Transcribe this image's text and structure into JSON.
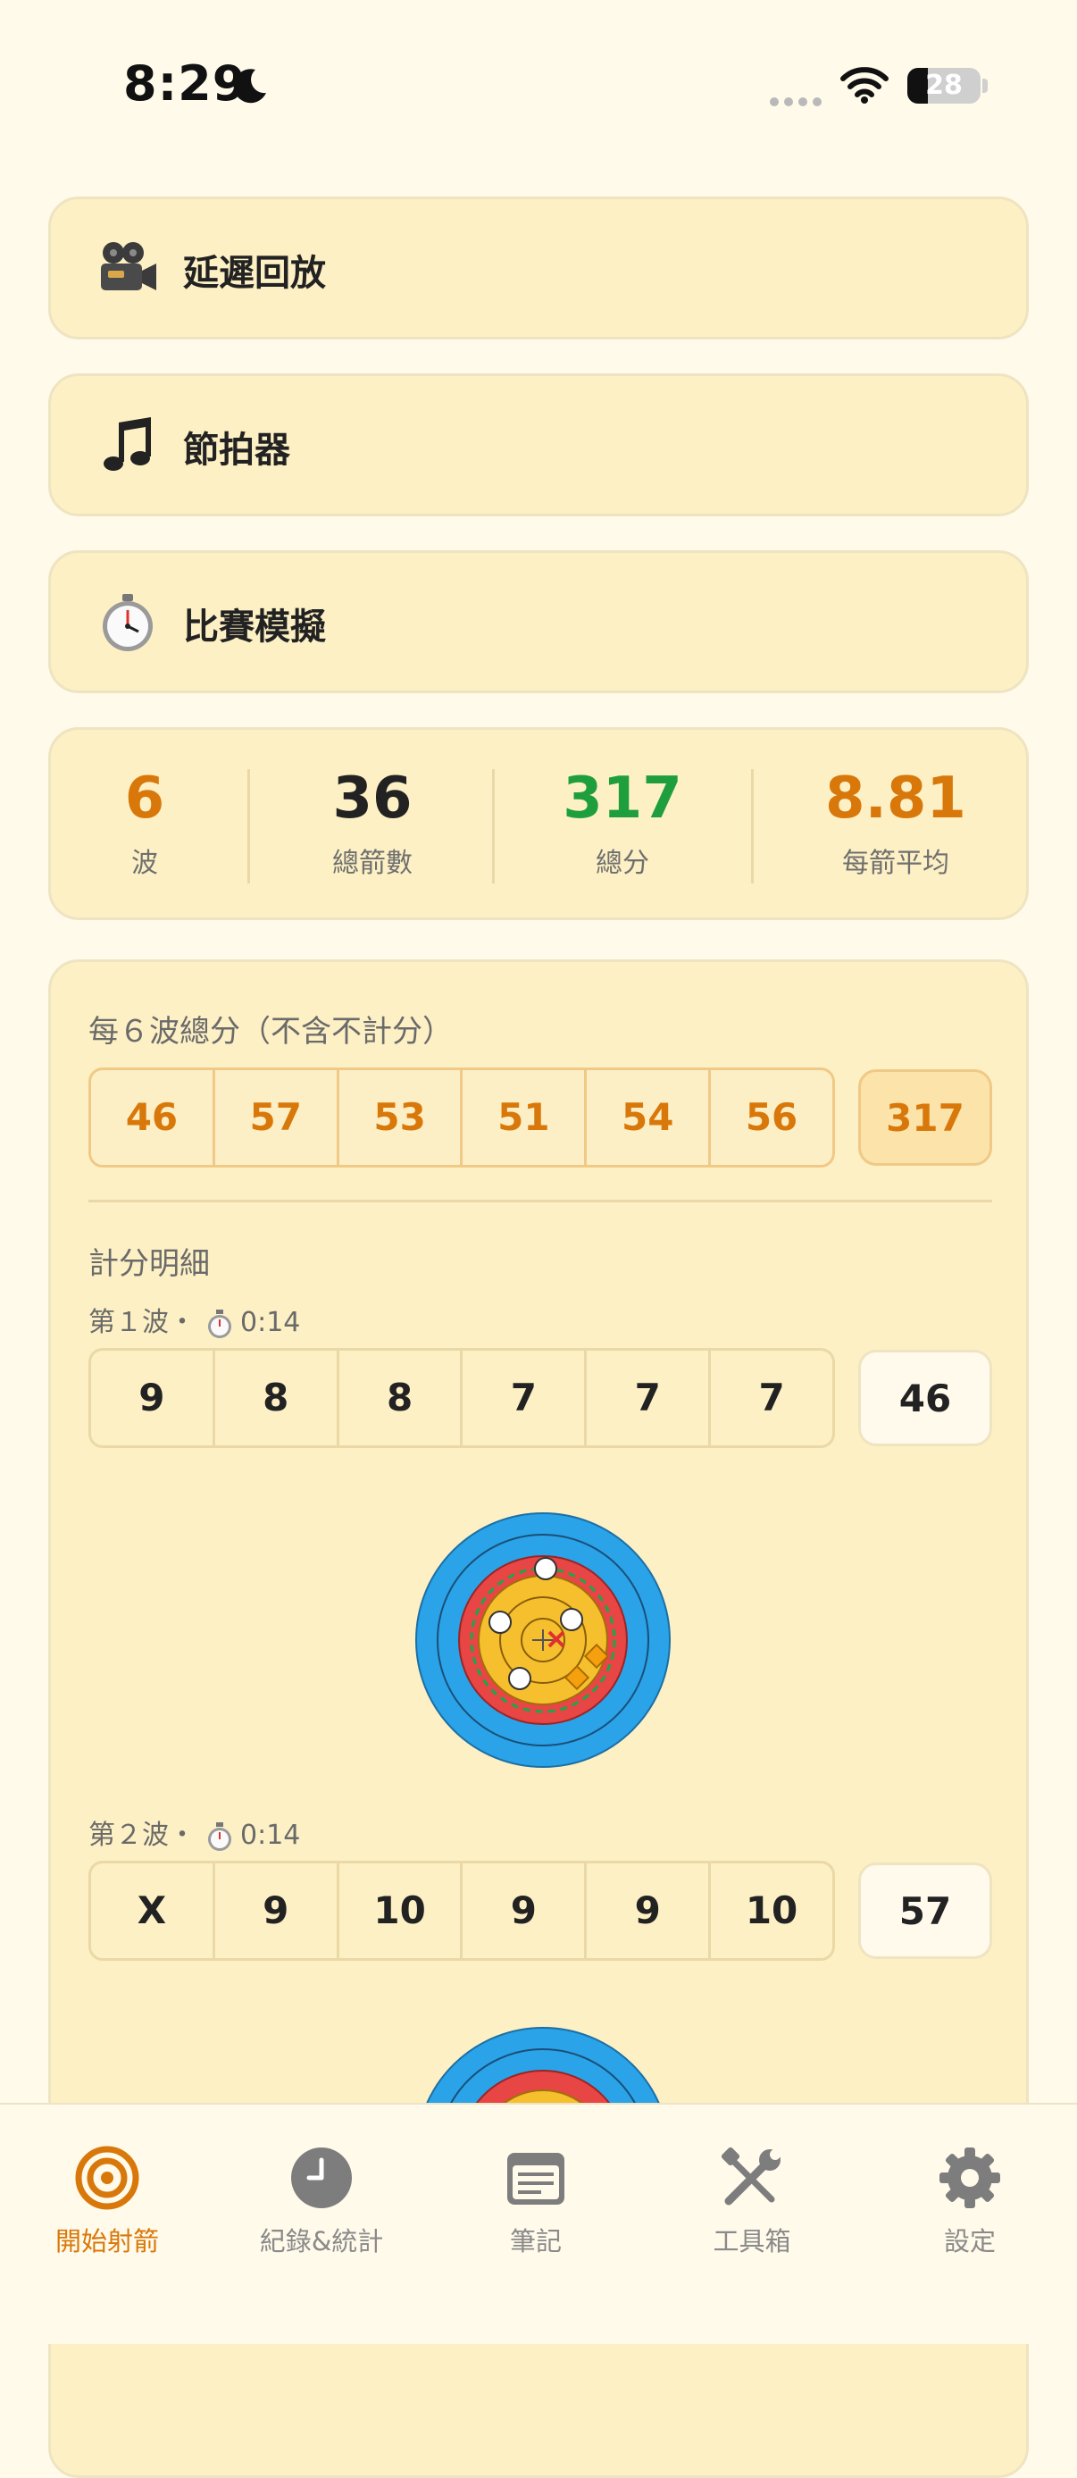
{
  "status_bar": {
    "time": "8:29",
    "battery": "28",
    "battery_level": 0.28
  },
  "menu": [
    {
      "icon": "movie-camera-icon",
      "label": "延遲回放"
    },
    {
      "icon": "music-note-icon",
      "label": "節拍器"
    },
    {
      "icon": "stopwatch-icon",
      "label": "比賽模擬"
    }
  ],
  "stats": [
    {
      "value": "6",
      "label": "波",
      "color": "#d9780a"
    },
    {
      "value": "36",
      "label": "總箭數",
      "color": "#222222"
    },
    {
      "value": "317",
      "label": "總分",
      "color": "#1f9e3d"
    },
    {
      "value": "8.81",
      "label": "每箭平均",
      "color": "#d9780a"
    }
  ],
  "summary": {
    "title": "每６波總分（不含不計分）",
    "values": [
      "46",
      "57",
      "53",
      "51",
      "54",
      "56"
    ],
    "total": "317"
  },
  "details": {
    "title": "計分明細",
    "rounds": [
      {
        "label": "第１波・",
        "time": "0:14",
        "scores": [
          "9",
          "8",
          "8",
          "7",
          "7",
          "7"
        ],
        "total": "46"
      },
      {
        "label": "第２波・",
        "time": "0:14",
        "scores": [
          "X",
          "9",
          "10",
          "9",
          "9",
          "10"
        ],
        "total": "57"
      }
    ]
  },
  "tabs": [
    {
      "label": "開始射箭",
      "icon": "target-icon",
      "active": true
    },
    {
      "label": "紀錄&統計",
      "icon": "clock-icon",
      "active": false
    },
    {
      "label": "筆記",
      "icon": "notes-icon",
      "active": false
    },
    {
      "label": "工具箱",
      "icon": "tools-icon",
      "active": false
    },
    {
      "label": "設定",
      "icon": "gear-icon",
      "active": false
    }
  ],
  "colors": {
    "accent": "#d9780a",
    "green": "#1f9e3d",
    "card": "#fdf0c4",
    "background": "#fffaea"
  }
}
